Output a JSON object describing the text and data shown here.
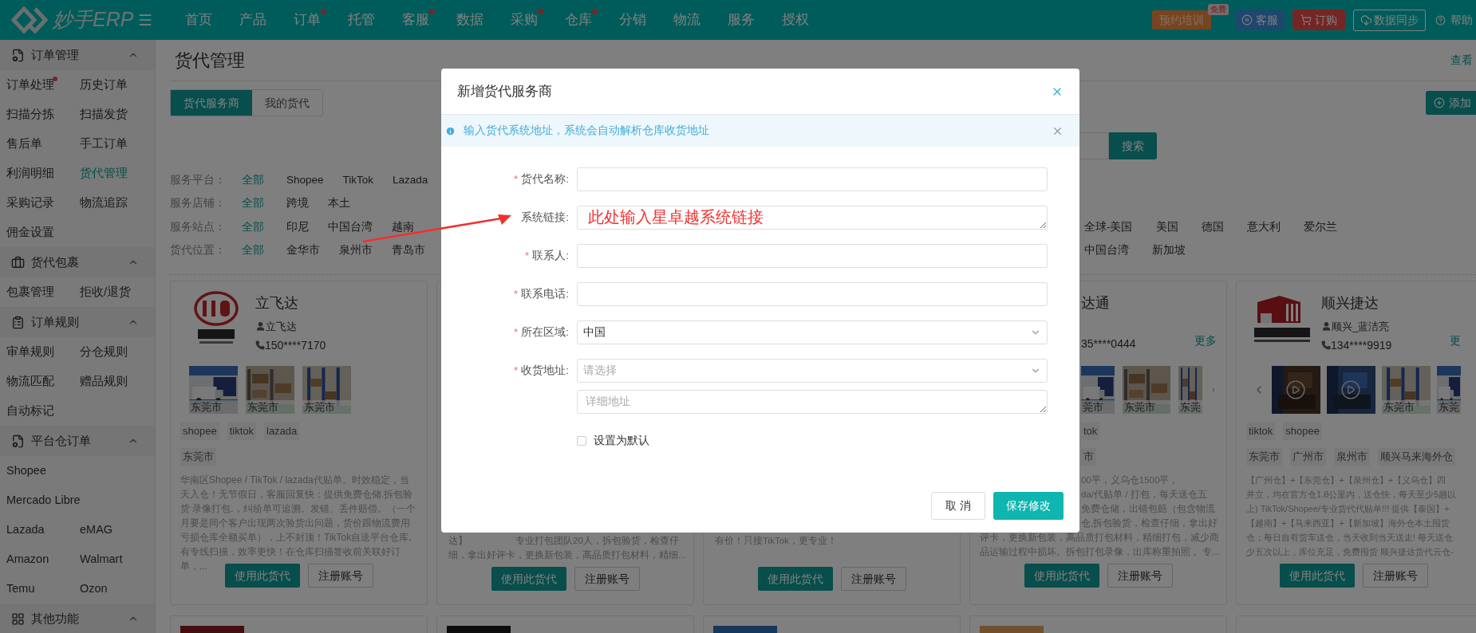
{
  "header": {
    "logo_text": "妙手ERP",
    "nav": [
      {
        "label": "首页",
        "dot": false
      },
      {
        "label": "产品",
        "dot": false
      },
      {
        "label": "订单",
        "dot": true
      },
      {
        "label": "托管",
        "dot": false
      },
      {
        "label": "客服",
        "dot": true
      },
      {
        "label": "数据",
        "dot": false
      },
      {
        "label": "采购",
        "dot": true
      },
      {
        "label": "仓库",
        "dot": true
      },
      {
        "label": "分销",
        "dot": false
      },
      {
        "label": "物流",
        "dot": false
      },
      {
        "label": "服务",
        "dot": false
      },
      {
        "label": "授权",
        "dot": false
      }
    ],
    "actions": [
      {
        "kind": "training",
        "label": "预约培训",
        "badge": "免费"
      },
      {
        "kind": "service",
        "label": "客服"
      },
      {
        "kind": "order",
        "label": "订购"
      },
      {
        "kind": "sync",
        "label": "数据同步"
      },
      {
        "kind": "help",
        "label": "帮助"
      }
    ]
  },
  "sidebar": {
    "groups": [
      {
        "title": "订单管理",
        "expanded": true,
        "rows": [
          [
            {
              "label": "订单处理",
              "dot": true,
              "selected": false
            },
            {
              "label": "历史订单",
              "dot": false,
              "selected": false
            }
          ],
          [
            {
              "label": "扫描分拣",
              "dot": false,
              "selected": false
            },
            {
              "label": "扫描发货",
              "dot": false,
              "selected": false
            }
          ],
          [
            {
              "label": "售后单",
              "dot": false,
              "selected": false
            },
            {
              "label": "手工订单",
              "dot": false,
              "selected": false
            }
          ],
          [
            {
              "label": "利润明细",
              "dot": false,
              "selected": false
            },
            {
              "label": "货代管理",
              "dot": false,
              "selected": true
            }
          ],
          [
            {
              "label": "采购记录",
              "dot": false,
              "selected": false
            },
            {
              "label": "物流追踪",
              "dot": false,
              "selected": false
            }
          ],
          [
            {
              "label": "佣金设置",
              "dot": false,
              "selected": false
            }
          ]
        ]
      },
      {
        "title": "货代包裹",
        "expanded": true,
        "rows": [
          [
            {
              "label": "包裹管理",
              "dot": false,
              "selected": false
            },
            {
              "label": "拒收/退货",
              "dot": false,
              "selected": false
            }
          ]
        ]
      },
      {
        "title": "订单规则",
        "expanded": true,
        "rows": [
          [
            {
              "label": "审单规则",
              "dot": false,
              "selected": false
            },
            {
              "label": "分仓规则",
              "dot": false,
              "selected": false
            }
          ],
          [
            {
              "label": "物流匹配",
              "dot": false,
              "selected": false
            },
            {
              "label": "赠品规则",
              "dot": false,
              "selected": false
            }
          ],
          [
            {
              "label": "自动标记",
              "dot": false,
              "selected": false
            }
          ]
        ]
      },
      {
        "title": "平台仓订单",
        "expanded": true,
        "rows": [
          [
            {
              "label": "Shopee",
              "dot": false,
              "selected": false
            }
          ],
          [
            {
              "label": "Mercado Libre",
              "dot": false,
              "selected": false
            }
          ],
          [
            {
              "label": "Lazada",
              "dot": false,
              "selected": false
            },
            {
              "label": "eMAG",
              "dot": false,
              "selected": false
            }
          ],
          [
            {
              "label": "Amazon",
              "dot": false,
              "selected": false
            },
            {
              "label": "Walmart",
              "dot": false,
              "selected": false
            }
          ],
          [
            {
              "label": "Temu",
              "dot": false,
              "selected": false
            },
            {
              "label": "Ozon",
              "dot": false,
              "selected": false
            }
          ]
        ]
      },
      {
        "title": "其他功能",
        "expanded": true
      }
    ]
  },
  "page": {
    "title": "货代管理",
    "link": "查看",
    "add_button": "添加",
    "tabs": [
      {
        "label": "货代服务商",
        "selected": true
      },
      {
        "label": "我的货代",
        "selected": false
      }
    ],
    "search_button": "搜索",
    "filters": [
      {
        "label": "服务平台：",
        "options": [
          {
            "label": "全部",
            "selected": true
          },
          {
            "label": "Shopee",
            "selected": false
          },
          {
            "label": "TikTok",
            "selected": false
          },
          {
            "label": "Lazada",
            "selected": false
          }
        ]
      },
      {
        "label": "服务店铺：",
        "options": [
          {
            "label": "全部",
            "selected": true
          },
          {
            "label": "跨境",
            "selected": false
          },
          {
            "label": "本土",
            "selected": false
          }
        ]
      },
      {
        "label": "服务站点：",
        "options": [
          {
            "label": "全部",
            "selected": true
          },
          {
            "label": "印尼",
            "selected": false
          },
          {
            "label": "中国台湾",
            "selected": false
          },
          {
            "label": "越南",
            "selected": false
          }
        ],
        "far_options": [
          {
            "label": "全球-美国",
            "selected": false
          },
          {
            "label": "美国",
            "selected": false
          },
          {
            "label": "德国",
            "selected": false
          },
          {
            "label": "意大利",
            "selected": false
          },
          {
            "label": "爱尔兰",
            "selected": false
          }
        ]
      },
      {
        "label": "货代位置：",
        "options": [
          {
            "label": "全部",
            "selected": true
          },
          {
            "label": "金华市",
            "selected": false
          },
          {
            "label": "泉州市",
            "selected": false
          },
          {
            "label": "青岛市",
            "selected": false
          }
        ],
        "far_options": [
          {
            "label": "中国台湾",
            "selected": false
          },
          {
            "label": "新加坡",
            "selected": false
          }
        ]
      }
    ]
  },
  "cards": [
    {
      "kind": "full",
      "title": "立飞达",
      "contact": "立飞达",
      "phone": "150****7170",
      "photos": [
        {
          "caption": "东莞市"
        },
        {
          "caption": "东莞市"
        },
        {
          "caption": "东莞市"
        }
      ],
      "platforms": [
        "shopee",
        "tiktok",
        "lazada"
      ],
      "locations": [
        "东莞市"
      ],
      "description": "华南区Shopee / TikTok / lazada代贴单。时效稳定，当天入仓！无节假日，客服回复快：提供免费仓储.拆包验货 录像打包.，纠纷单可追溯。发错、丢件赔偿。（一个月要是同个客户出现两次验货出问题，货价跟物流费用亏损仓库全额买单），上不封顶！TikTok自送平台仓库,有专线扫描，效率更快！在仓库扫描签收前关联好订单，...",
      "buttons": [
        "使用此货代",
        "注册账号"
      ]
    },
    {
      "kind": "covered",
      "description_lines": [
        "达】　　　　　专业打包团队20人，拆包验货，检查仔",
        "细，拿出好评卡，更换新包装，高品质打包材料，精细..."
      ],
      "buttons": [
        "使用此货代",
        "注册账号"
      ]
    },
    {
      "kind": "covered",
      "description_lines": [
        "有价！只接TikTok，更专业！"
      ],
      "buttons": [
        "使用此货代",
        "注册账号"
      ]
    },
    {
      "kind": "edge",
      "title": "达通",
      "phone": "35****0444",
      "more": "更多",
      "photos": [
        {
          "caption": "莞市"
        },
        {
          "caption": "东莞市"
        },
        {
          "caption": "东莞"
        }
      ],
      "platforms": [
        "tok"
      ],
      "locations": [
        "市"
      ],
      "description_lines": [
        "00平，义乌仓1500平，",
        "da/代贴单 / 打包，每天送仓五",
        "免费仓储，出错包赔（包含物流",
        "仓,拆包验货，检查仔细，拿出好",
        "评卡，更换新包装，高品质打包材料，精细打包，减少商",
        "品运输过程中损坏。拆包打包录像，出库称重拍照 。专..."
      ],
      "buttons": [
        "使用此货代",
        "注册账号"
      ]
    },
    {
      "kind": "full",
      "title": "顺兴捷达",
      "contact": "顺兴_蓝洁亮",
      "phone": "134****9919",
      "more": "更",
      "photos": [
        {
          "kind": "video"
        },
        {
          "kind": "video"
        },
        {
          "caption": "东莞市"
        },
        {
          "caption": "东莞"
        }
      ],
      "platforms": [
        "tiktok",
        "shopee"
      ],
      "locations": [
        "东莞市",
        "广州市",
        "泉州市",
        "顺兴马来海外仓"
      ],
      "description_lines": [
        "【广州仓】+【东莞仓】+【泉州仓】+【义乌仓】四",
        "并立，均在官方仓1.8公里内，送仓快，每天至少5趟以",
        "上) TikTok/Shopee/专业货代代贴单!!! 提供【泰国】+",
        "【越南】+【马来西亚】+【新加坡】海外仓本土囤货",
        "仓；每日自有货车送仓，当天收到当天送走! 每天送仓",
        "少五次以上，库位充足，免费囤货 顺兴捷达货代云仓-"
      ],
      "buttons": [
        "使用此货代",
        "注册账号"
      ]
    }
  ],
  "dialog": {
    "title": "新增货代服务商",
    "notice": "输入货代系统地址，系统会自动解析仓库收货地址",
    "fields": [
      {
        "kind": "input",
        "label": "货代名称:",
        "asterisk": "*"
      },
      {
        "kind": "textarea",
        "label": "系统链接:"
      },
      {
        "kind": "input",
        "label": "联系人:",
        "asterisk": "*"
      },
      {
        "kind": "input",
        "label": "联系电话:",
        "asterisk": "*"
      },
      {
        "kind": "select",
        "label": "所在区域:",
        "asterisk": "*",
        "value": "中国"
      },
      {
        "kind": "select",
        "label": "收货地址:",
        "asterisk": "*",
        "placeholder": "请选择"
      },
      {
        "kind": "textarea",
        "placeholder": "详细地址"
      }
    ],
    "checkbox": {
      "label": "设置为默认",
      "checked": false
    },
    "buttons": [
      {
        "kind": "cancel",
        "label": "取 消"
      },
      {
        "kind": "primary",
        "label": "保存修改"
      }
    ]
  },
  "annotation": {
    "text": "此处输入星卓越系统链接"
  }
}
